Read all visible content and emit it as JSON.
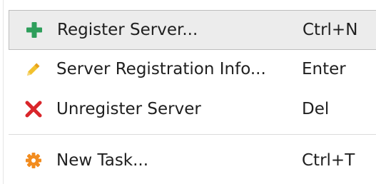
{
  "menu": {
    "items": [
      {
        "label": "Register Server...",
        "shortcut": "Ctrl+N",
        "icon": "plus-icon",
        "icon_color": "#2e9e5b"
      },
      {
        "label": "Server Registration Info...",
        "shortcut": "Enter",
        "icon": "pencil-icon",
        "icon_color": "#f2c12e"
      },
      {
        "label": "Unregister Server",
        "shortcut": "Del",
        "icon": "x-mark-icon",
        "icon_color": "#d9262b"
      },
      {
        "label": "New Task...",
        "shortcut": "Ctrl+T",
        "icon": "gear-icon",
        "icon_color": "#f28c1f"
      }
    ]
  }
}
